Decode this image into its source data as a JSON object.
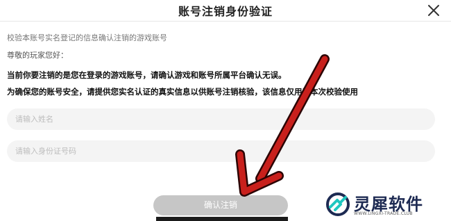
{
  "dialog": {
    "title": "账号注销身份验证",
    "close_icon": "close-icon",
    "subtitle": "校验本账号实名登记的信息确认注销的游戏账号",
    "greeting": "尊敬的玩家您好：",
    "notice_line1": "当前你要注销的是您在登录的游戏账号，请确认游戏和账号所属平台确认无误。",
    "notice_line2": "为确保您的账号安全，请提供您实名认证的真实信息以供账号注销核验，该信息仅用于本次校验使用",
    "fields": {
      "name_placeholder": "请输入姓名",
      "id_placeholder": "请输入身份证号码"
    },
    "confirm_label": "确认注销"
  },
  "annotation": {
    "arrow_icon": "red-arrow-icon",
    "color": "#c8201c"
  },
  "watermark": {
    "name": "灵犀软件",
    "url": "WWW.LINGXI-TRADE.CLUB",
    "logo_icon": "lingxi-logo-icon",
    "colors": {
      "navy": "#1d2a52",
      "teal": "#1fc7c0"
    }
  }
}
